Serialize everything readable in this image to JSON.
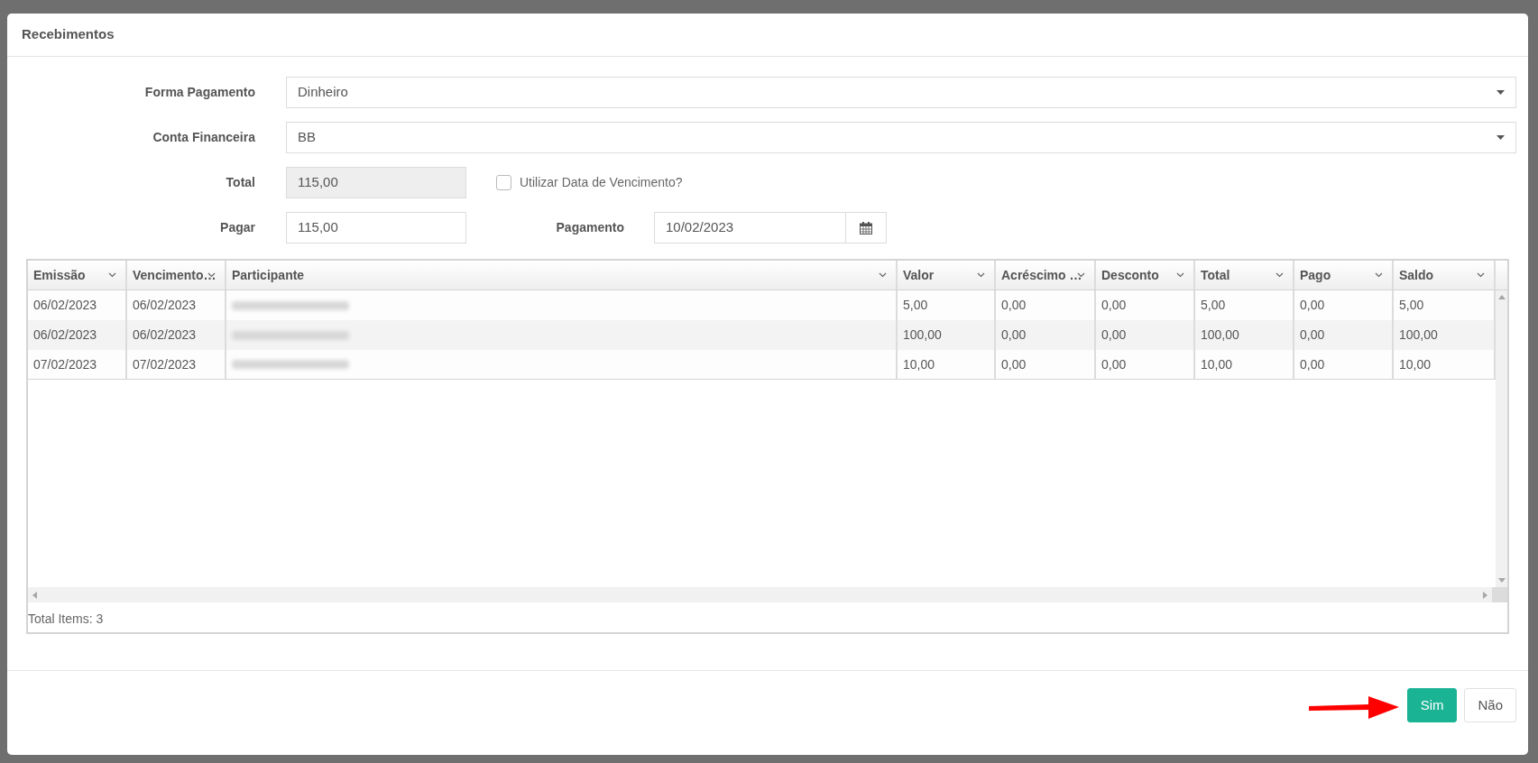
{
  "dialog": {
    "title": "Recebimentos"
  },
  "form_rows": [
    {
      "label": "Forma Pagamento",
      "field": {
        "kind": "select",
        "value": "Dinheiro"
      }
    },
    {
      "label": "Conta Financeira",
      "field": {
        "kind": "select",
        "value": "BB"
      }
    },
    {
      "label": "Total",
      "field": {
        "kind": "readonly",
        "value": "115,00"
      },
      "extra": {
        "kind": "checkbox",
        "label": "Utilizar Data de Vencimento?",
        "checked": false
      }
    },
    {
      "label": "Pagar",
      "field": {
        "kind": "text",
        "value": "115,00"
      },
      "extra": {
        "kind": "date",
        "label": "Pagamento",
        "value": "10/02/2023"
      }
    }
  ],
  "table": {
    "columns": [
      "Emissão",
      "Vencimento…",
      "Participante",
      "Valor",
      "Acréscimo …",
      "Desconto",
      "Total",
      "Pago",
      "Saldo"
    ],
    "rows": [
      {
        "cells": [
          "06/02/2023",
          "06/02/2023",
          null,
          "5,00",
          "0,00",
          "0,00",
          "5,00",
          "0,00",
          "5,00"
        ]
      },
      {
        "cells": [
          "06/02/2023",
          "06/02/2023",
          null,
          "100,00",
          "0,00",
          "0,00",
          "100,00",
          "0,00",
          "100,00"
        ]
      },
      {
        "cells": [
          "07/02/2023",
          "07/02/2023",
          null,
          "10,00",
          "0,00",
          "0,00",
          "10,00",
          "0,00",
          "10,00"
        ]
      }
    ],
    "footer": "Total Items: 3"
  },
  "buttons": [
    {
      "label": "Sim",
      "kind": "primary"
    },
    {
      "label": "Não",
      "kind": "default"
    }
  ]
}
